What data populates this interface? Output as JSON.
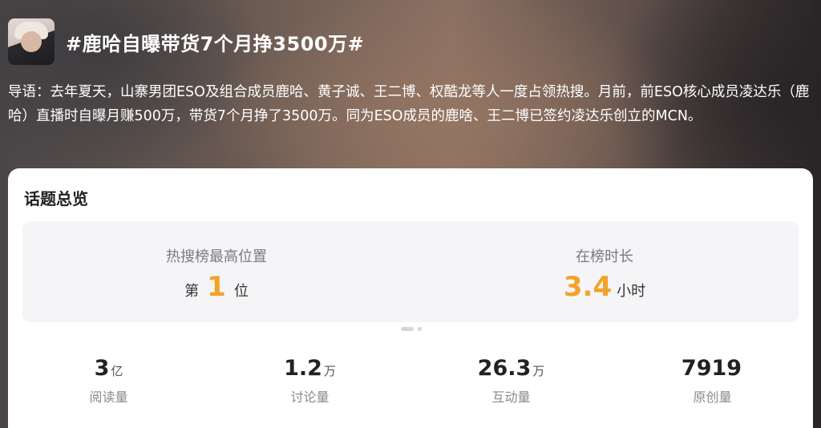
{
  "header": {
    "title": "#鹿哈自曝带货7个月挣3500万#"
  },
  "intro": {
    "text": "导语：去年夏天，山寨男团ESO及组合成员鹿哈、黄子诚、王二博、权酷龙等人一度占领热搜。月前，前ESO核心成员凌达乐（鹿哈）直播时自曝月赚500万，带货7个月挣了3500万。同为ESO成员的鹿啥、王二博已签约凌达乐创立的MCN。"
  },
  "overview": {
    "title": "话题总览",
    "rank": {
      "label": "热搜榜最高位置",
      "prefix": "第",
      "value": "1",
      "suffix": "位"
    },
    "duration": {
      "label": "在榜时长",
      "value": "3.4",
      "unit": "小时"
    },
    "accent_color": "#f3a22a"
  },
  "stats": [
    {
      "value": "3",
      "unit": "亿",
      "label": "阅读量"
    },
    {
      "value": "1.2",
      "unit": "万",
      "label": "讨论量"
    },
    {
      "value": "26.3",
      "unit": "万",
      "label": "互动量"
    },
    {
      "value": "7919",
      "unit": "",
      "label": "原创量"
    }
  ]
}
